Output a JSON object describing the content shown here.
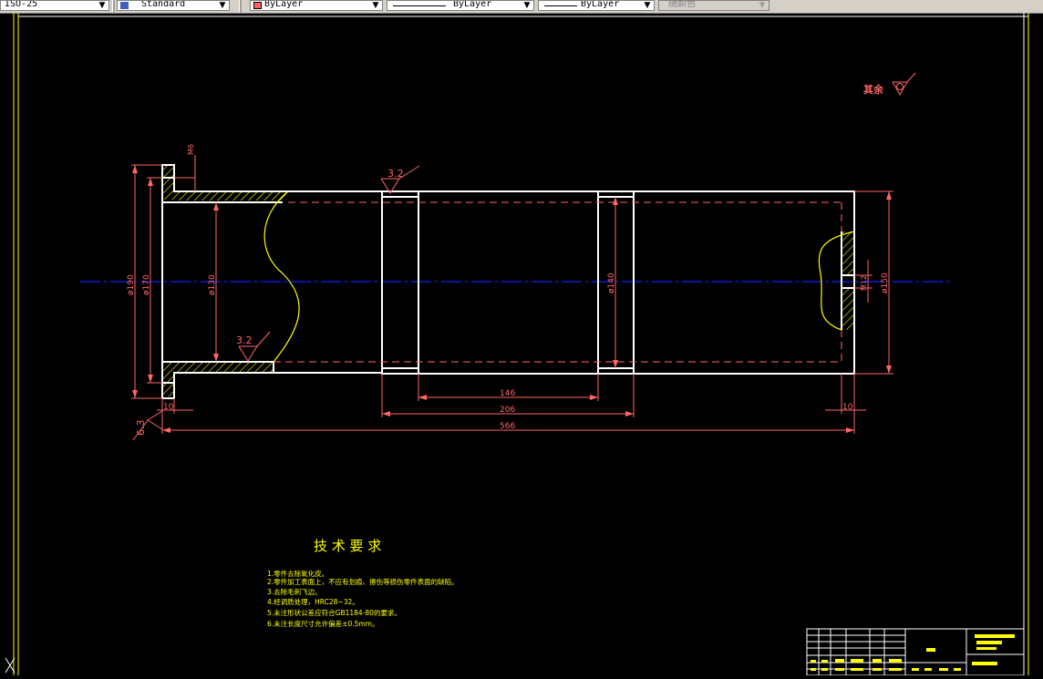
{
  "toolbar": {
    "dimstyle": "ISO-25",
    "textstyle": "Standard",
    "layer_color": "ByLayer",
    "linetype": "ByLayer",
    "lineweight": "ByLayer",
    "plotstyle": "随颜色",
    "colors": {
      "bg": "#d4d0c8",
      "swatch": "#ff6060"
    }
  },
  "drawing": {
    "roughness_other_label": "其余",
    "roughness_top": "3.2",
    "roughness_bottom": "3.2",
    "roughness_left": "6.3",
    "dim_d190": "ø190",
    "dim_d170": "ø170",
    "dim_d130": "ø130",
    "dim_d140": "ø140",
    "dim_d150": "ø150",
    "dim_m6": "M6",
    "dim_m12": "M12",
    "dim_146": "146",
    "dim_206": "206",
    "dim_566": "566",
    "dim_10_left": "10",
    "dim_10_right": "10",
    "tech_title": "技 术 要 求",
    "tech_notes": [
      "1.零件去除氧化皮。",
      "2.零件加工表面上，不应有划痕、擦伤等损伤零件表面的缺陷。",
      "3.去除毛刺飞边。",
      "4.经调质处理，HRC28~32。",
      "5.未注形状公差应符合GB1184-80的要求。",
      "6.未注长度尺寸允许偏差±0.5mm。"
    ],
    "colors": {
      "outline": "#ffffff",
      "dimension": "#ff6666",
      "centerline": "#1020ff",
      "hatch": "#ffff00",
      "notes": "#ffff00",
      "border": "#ffff00"
    }
  }
}
